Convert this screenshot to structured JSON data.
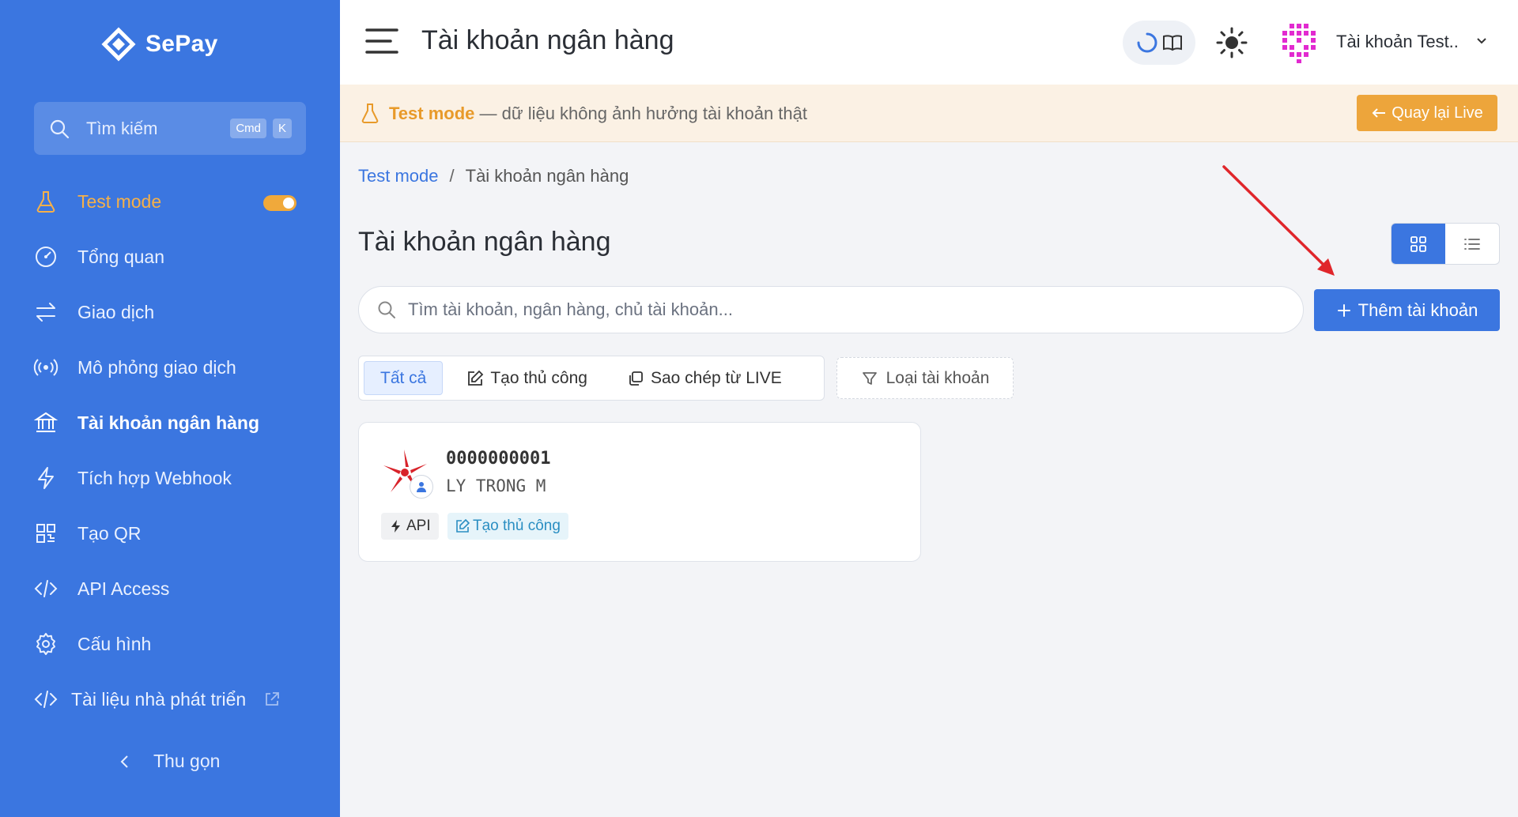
{
  "sidebar": {
    "brand": "SePay",
    "search": {
      "placeholder": "Tìm kiếm",
      "kbd1": "Cmd",
      "kbd2": "K"
    },
    "items": [
      {
        "label": "Test mode"
      },
      {
        "label": "Tổng quan"
      },
      {
        "label": "Giao dịch"
      },
      {
        "label": "Mô phỏng giao dịch"
      },
      {
        "label": "Tài khoản ngân hàng"
      },
      {
        "label": "Tích hợp Webhook"
      },
      {
        "label": "Tạo QR"
      },
      {
        "label": "API Access"
      },
      {
        "label": "Cấu hình"
      },
      {
        "label": "Tài liệu nhà phát triển"
      }
    ],
    "test_mode_on": true,
    "collapse": "Thu gọn"
  },
  "header": {
    "title": "Tài khoản ngân hàng",
    "user": "Tài khoản Test.."
  },
  "banner": {
    "mode": "Test mode",
    "text": " — dữ liệu không ảnh hưởng tài khoản thật",
    "back_button": "Quay lại Live"
  },
  "breadcrumb": {
    "parent": "Test mode",
    "separator": "/",
    "current": "Tài khoản ngân hàng"
  },
  "main": {
    "title": "Tài khoản ngân hàng",
    "search_placeholder": "Tìm tài khoản, ngân hàng, chủ tài khoản...",
    "add_button": "Thêm tài khoản",
    "filters": [
      "Tất cả",
      "Tạo thủ công",
      "Sao chép từ LIVE"
    ],
    "type_filter": "Loại tài khoản",
    "view": "grid"
  },
  "accounts": [
    {
      "number": "0000000001",
      "holder": "LY TRONG M",
      "tags": [
        "API",
        "Tạo thủ công"
      ]
    }
  ],
  "colors": {
    "sidebar": "#3b76e0",
    "primary": "#3b76e0",
    "warning": "#eda53b",
    "annotation_arrow": "#e0262b"
  }
}
